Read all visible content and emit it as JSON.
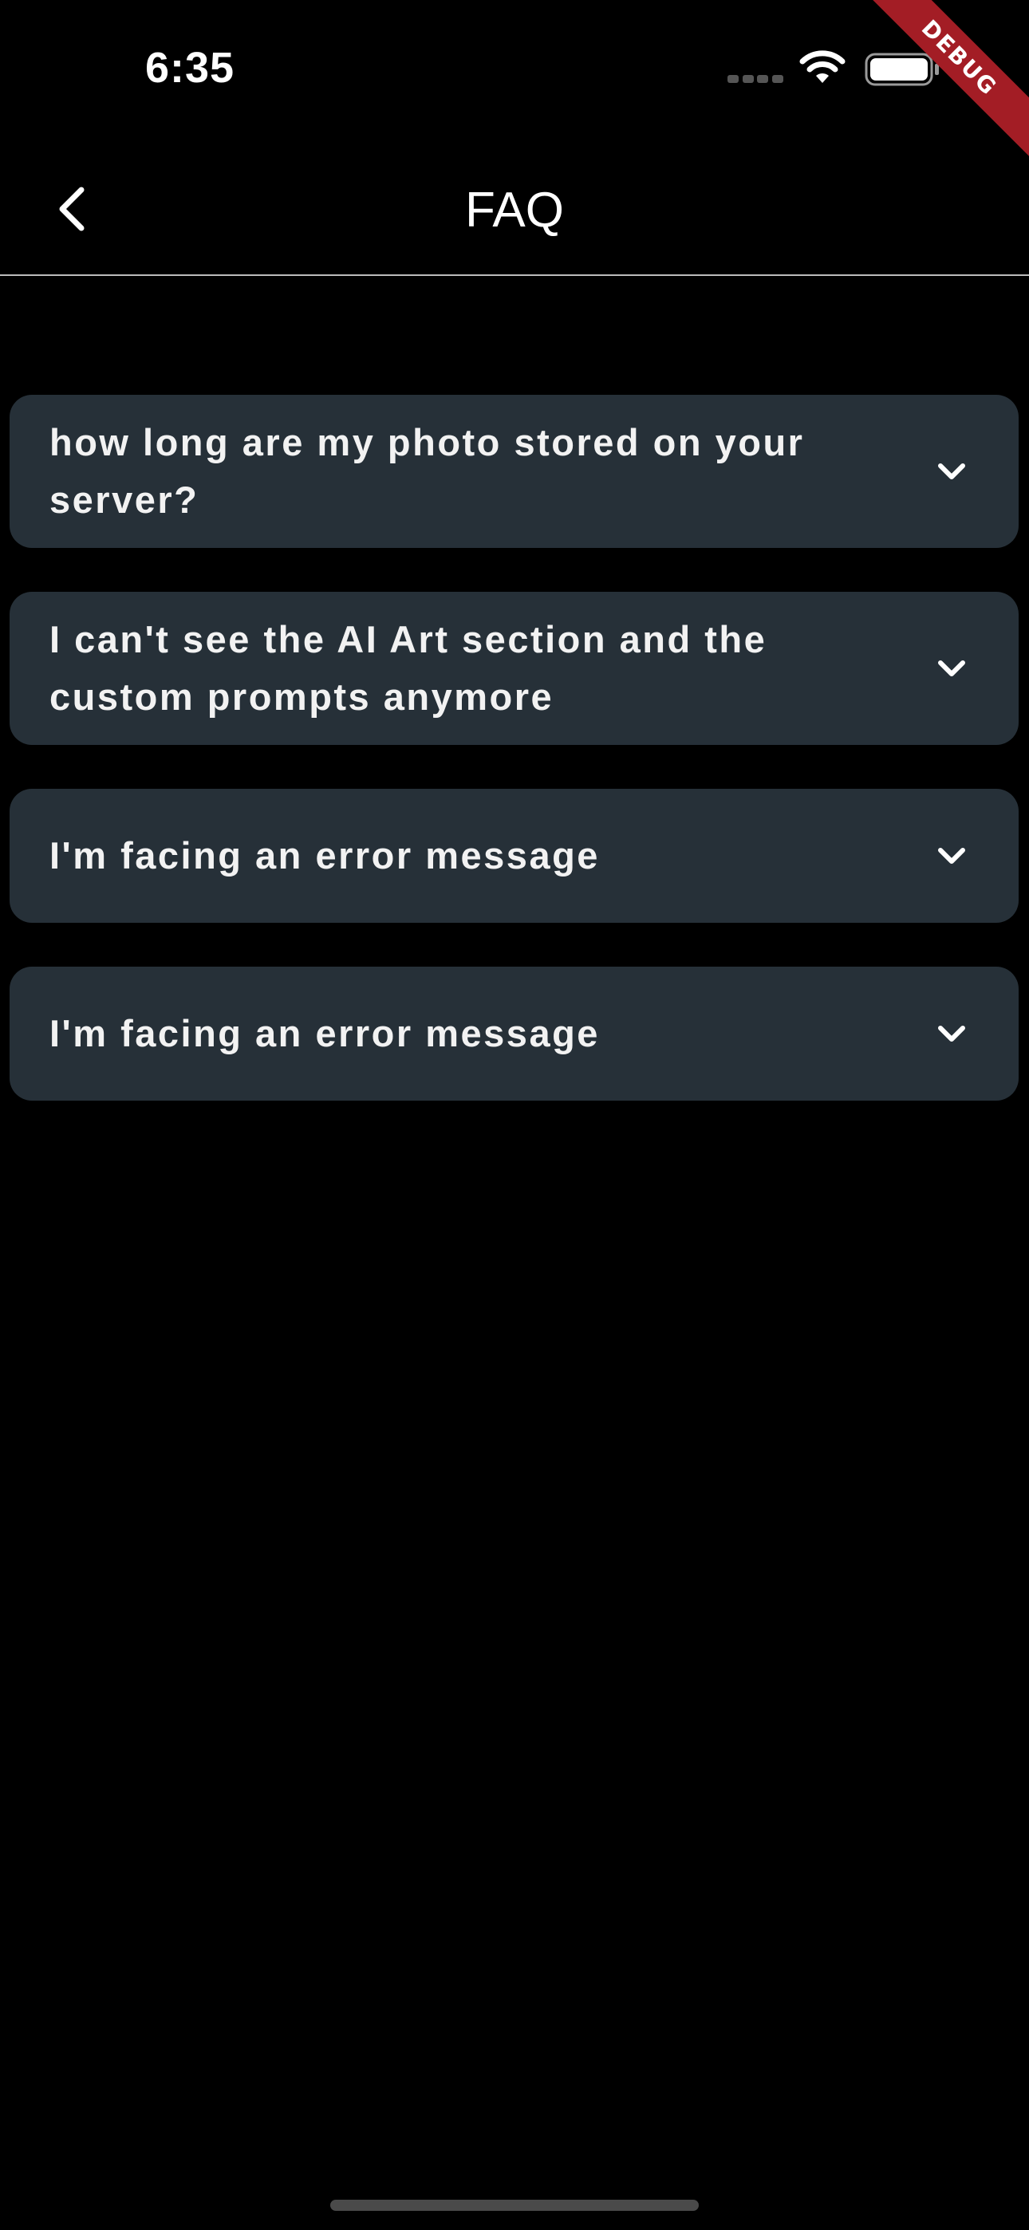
{
  "status_bar": {
    "time": "6:35",
    "icons": [
      "signal-icon",
      "wifi-icon",
      "battery-icon"
    ]
  },
  "debug_banner": "DEBUG",
  "nav": {
    "back_icon": "chevron-left-icon",
    "title": "FAQ"
  },
  "faq": {
    "items": [
      {
        "question": "how long are my photo stored on your server?",
        "expanded": false
      },
      {
        "question": "I can't see the AI Art section and the custom prompts anymore",
        "expanded": false
      },
      {
        "question": "I'm facing an error message",
        "expanded": false
      },
      {
        "question": "I'm facing an error message",
        "expanded": false
      }
    ],
    "toggle_icon": "chevron-down-icon"
  },
  "colors": {
    "background": "#000000",
    "card": "#263038",
    "text": "#ffffff",
    "divider": "#bdbdbd",
    "debug_ribbon": "#a31d25"
  }
}
